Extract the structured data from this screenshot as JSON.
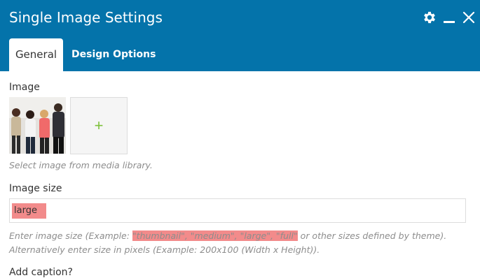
{
  "header": {
    "title": "Single Image Settings",
    "icons": [
      "gear-icon",
      "minimize-icon",
      "close-icon"
    ]
  },
  "tabs": [
    {
      "label": "General",
      "active": true
    },
    {
      "label": "Design Options",
      "active": false
    }
  ],
  "image_field": {
    "label": "Image",
    "help": "Select image from media library.",
    "add_symbol": "+"
  },
  "image_size_field": {
    "label": "Image size",
    "value": "large",
    "help_prefix": "Enter image size (Example: ",
    "help_highlight": "\"thumbnail\", \"medium\", \"large\", \"full\"",
    "help_suffix": " or other sizes defined by theme).",
    "help_line2": "Alternatively enter size in pixels (Example: 200x100 (Width x Height))."
  },
  "caption_field": {
    "label": "Add caption?"
  },
  "colors": {
    "header_bg": "#0473aa",
    "highlight": "#f28b8b",
    "add_plus": "#7ec13b"
  }
}
